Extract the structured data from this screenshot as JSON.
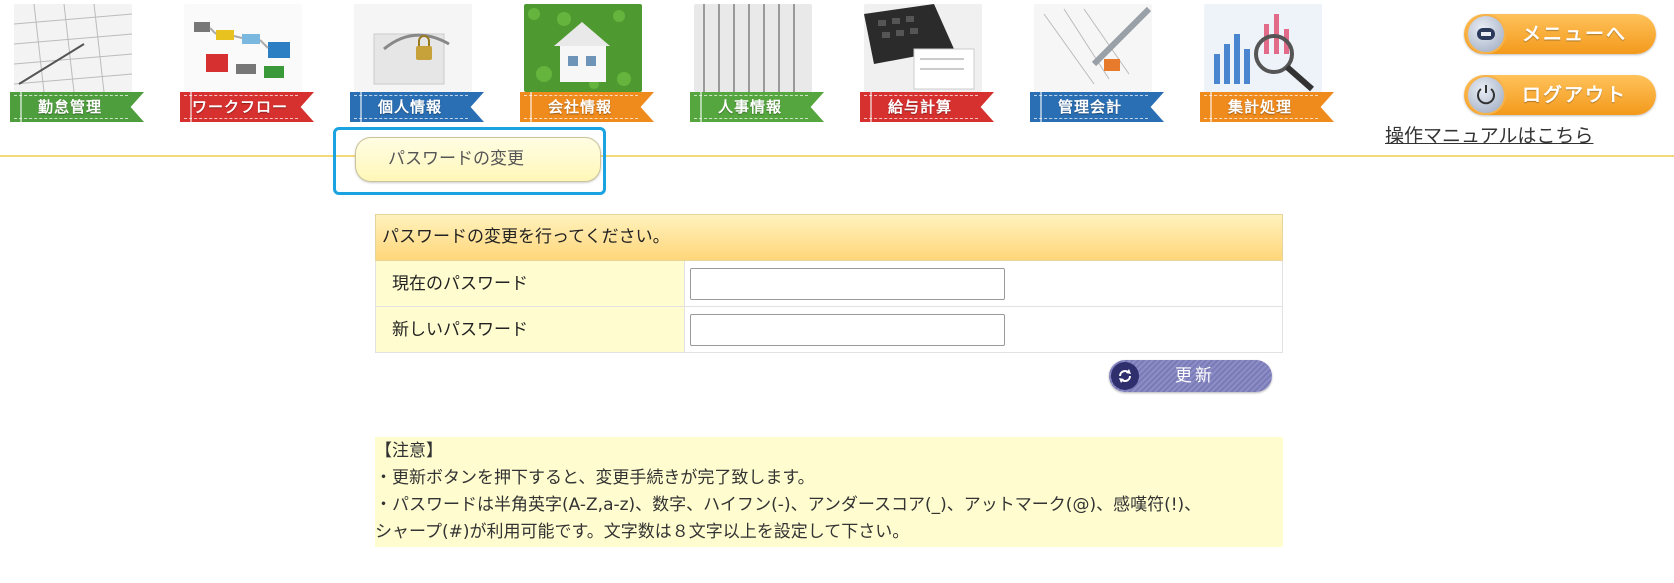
{
  "nav": {
    "items": [
      {
        "label": "勤怠管理",
        "color": "#4f9e3e"
      },
      {
        "label": "ワークフロー",
        "color": "#d6302f"
      },
      {
        "label": "個人情報",
        "color": "#2a6fb4"
      },
      {
        "label": "会社情報",
        "color": "#ef8a1c"
      },
      {
        "label": "人事情報",
        "color": "#55a63e"
      },
      {
        "label": "給与計算",
        "color": "#d6302f"
      },
      {
        "label": "管理会計",
        "color": "#2a6fb4"
      },
      {
        "label": "集計処理",
        "color": "#ef8a1c"
      }
    ]
  },
  "side": {
    "menu_label": "メニューへ",
    "logout_label": "ログアウト",
    "manual_link": "操作マニュアルはこちら"
  },
  "submenu": {
    "item_label": "パスワードの変更"
  },
  "form": {
    "title": "パスワードの変更を行ってください。",
    "current_password_label": "現在のパスワード",
    "new_password_label": "新しいパスワード",
    "current_password_value": "",
    "new_password_value": "",
    "update_label": "更新"
  },
  "notice": {
    "heading": "【注意】",
    "line1": "・更新ボタンを押下すると、変更手続きが完了致します。",
    "line2": "・パスワードは半角英字(A-Z,a-z)、数字、ハイフン(-)、アンダースコア(_)、アットマーク(@)、感嘆符(!)、",
    "line3": "シャープ(#)が利用可能です。文字数は８文字以上を設定して下さい。"
  },
  "colors": {
    "accent_orange": "#f39a1c",
    "highlight_blue": "#1aa3e0",
    "header_line": "#f3d97a",
    "label_bg": "#fffdd0",
    "update_button": "#7a7bb6"
  }
}
